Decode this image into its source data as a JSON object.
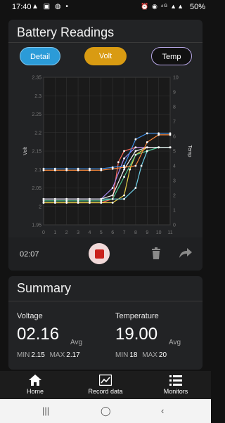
{
  "status": {
    "time": "17:40",
    "left_icons": "▲ ▣ ◍ •",
    "right_icons": "⏰ ◉ ⁴ᴳ ▲▲",
    "battery": "50%"
  },
  "readings": {
    "title": "Battery Readings",
    "tabs": {
      "detail": "Detail",
      "volt": "Volt",
      "temp": "Temp"
    },
    "elapsed": "02:07"
  },
  "chart_data": {
    "type": "line",
    "xlabel": "",
    "ylabel": "Volt",
    "y2label": "Temp",
    "x_ticks": [
      "0",
      "1",
      "2",
      "3",
      "4",
      "5",
      "6",
      "7",
      "8",
      "9",
      "10",
      "11"
    ],
    "y_ticks": [
      "1.95",
      "2",
      "2.05",
      "2.1",
      "2.15",
      "2.2",
      "2.25",
      "2.3",
      "2.35"
    ],
    "y2_ticks": [
      "0",
      "1",
      "2",
      "3",
      "4",
      "5",
      "6",
      "7",
      "8",
      "9",
      "10"
    ],
    "xlim": [
      0,
      11
    ],
    "ylim": [
      1.95,
      2.35
    ],
    "y2lim": [
      0,
      10
    ],
    "volt_series": [
      {
        "color": "#ff6a5a",
        "x": [
          0,
          1,
          2,
          3,
          4,
          5,
          6,
          6.5,
          7,
          8,
          9,
          10,
          11
        ],
        "y": [
          2.01,
          2.01,
          2.01,
          2.01,
          2.01,
          2.01,
          2.02,
          2.12,
          2.15,
          2.16,
          2.16,
          2.16,
          2.16
        ]
      },
      {
        "color": "#e8d24a",
        "x": [
          0,
          1,
          2,
          3,
          4,
          5,
          6,
          7,
          7.5,
          8,
          9,
          10,
          11
        ],
        "y": [
          2.01,
          2.01,
          2.01,
          2.01,
          2.01,
          2.01,
          2.01,
          2.03,
          2.1,
          2.14,
          2.16,
          2.16,
          2.16
        ]
      },
      {
        "color": "#6fd0e8",
        "x": [
          0,
          1,
          2,
          3,
          4,
          5,
          6,
          7,
          8,
          8.5,
          9,
          10,
          11
        ],
        "y": [
          2.02,
          2.02,
          2.02,
          2.02,
          2.02,
          2.02,
          2.02,
          2.02,
          2.05,
          2.11,
          2.15,
          2.16,
          2.16
        ]
      },
      {
        "color": "#a58bf0",
        "x": [
          0,
          1,
          2,
          3,
          4,
          5,
          6,
          7,
          8,
          9,
          10,
          11
        ],
        "y": [
          2.02,
          2.02,
          2.02,
          2.02,
          2.02,
          2.02,
          2.05,
          2.13,
          2.16,
          2.16,
          2.16,
          2.16
        ]
      },
      {
        "color": "#4cc38a",
        "x": [
          0,
          1,
          2,
          3,
          4,
          5,
          6,
          7,
          8,
          9,
          10,
          11
        ],
        "y": [
          2.015,
          2.015,
          2.015,
          2.015,
          2.015,
          2.015,
          2.02,
          2.08,
          2.14,
          2.15,
          2.16,
          2.16
        ]
      },
      {
        "color": "#f0f0f0",
        "x": [
          0,
          1,
          2,
          3,
          4,
          5,
          6,
          7,
          8,
          9,
          10,
          11
        ],
        "y": [
          2.02,
          2.02,
          2.02,
          2.02,
          2.02,
          2.02,
          2.03,
          2.1,
          2.15,
          2.16,
          2.16,
          2.16
        ]
      }
    ],
    "temp_series": [
      {
        "color": "#ff8a3a",
        "x": [
          0,
          1,
          2,
          3,
          4,
          5,
          6,
          7,
          8,
          9,
          10,
          11
        ],
        "y": [
          3.7,
          3.7,
          3.7,
          3.7,
          3.7,
          3.7,
          3.8,
          3.9,
          4.0,
          5.6,
          6.1,
          6.1
        ]
      },
      {
        "color": "#3f8fe8",
        "x": [
          0,
          1,
          2,
          3,
          4,
          5,
          6,
          7,
          8,
          9,
          10,
          11
        ],
        "y": [
          3.8,
          3.8,
          3.8,
          3.8,
          3.8,
          3.8,
          3.9,
          4.0,
          5.8,
          6.2,
          6.2,
          6.2
        ]
      }
    ]
  },
  "summary": {
    "title": "Summary",
    "voltage": {
      "label": "Voltage",
      "value": "02.16",
      "avg": "Avg",
      "min_label": "MIN",
      "min": "2.15",
      "max_label": "MAX",
      "max": "2.17"
    },
    "temperature": {
      "label": "Temperature",
      "value": "19.00",
      "avg": "Avg",
      "min_label": "MIN",
      "min": "18",
      "max_label": "MAX",
      "max": "20"
    }
  },
  "nav": {
    "home": "Home",
    "record": "Record data",
    "monitors": "Monitors"
  },
  "colors": {
    "detail": "#2b9bd8",
    "volt": "#d99b12",
    "record": "#c9201b",
    "card": "#222325"
  }
}
